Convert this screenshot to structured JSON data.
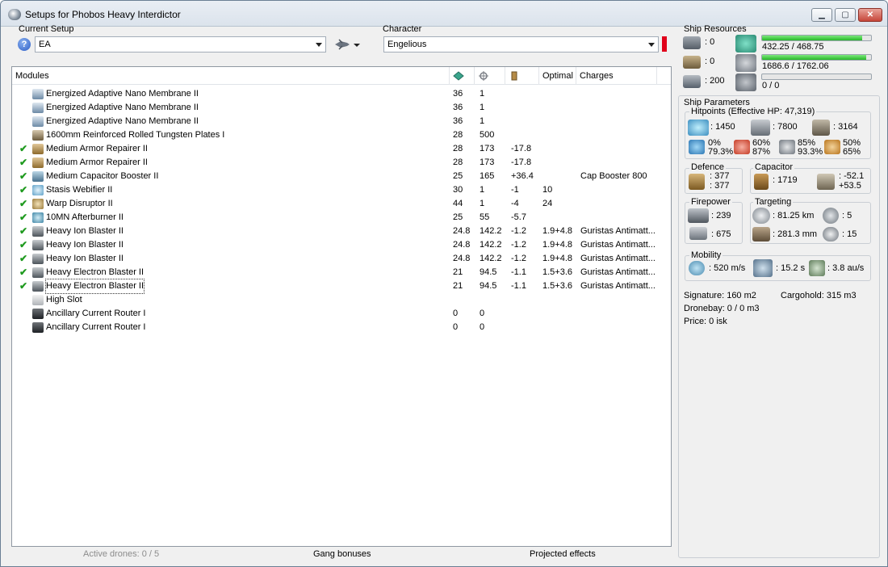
{
  "window": {
    "title": "Setups for Phobos Heavy Interdictor"
  },
  "setup": {
    "label": "Current Setup",
    "value": "EA"
  },
  "character": {
    "label": "Character",
    "value": "Engelious"
  },
  "modules": {
    "headers": {
      "modules": "Modules",
      "optimal": "Optimal",
      "charges": "Charges"
    },
    "rows": [
      {
        "checked": false,
        "name": "Energized Adaptive Nano Membrane II",
        "cpu": "36",
        "pg": "1",
        "cap": "",
        "optimal": "",
        "charges": "",
        "icon": "membrane-icon"
      },
      {
        "checked": false,
        "name": "Energized Adaptive Nano Membrane II",
        "cpu": "36",
        "pg": "1",
        "cap": "",
        "optimal": "",
        "charges": "",
        "icon": "membrane-icon"
      },
      {
        "checked": false,
        "name": "Energized Adaptive Nano Membrane II",
        "cpu": "36",
        "pg": "1",
        "cap": "",
        "optimal": "",
        "charges": "",
        "icon": "membrane-icon"
      },
      {
        "checked": false,
        "name": "1600mm Reinforced Rolled Tungsten Plates I",
        "cpu": "28",
        "pg": "500",
        "cap": "",
        "optimal": "",
        "charges": "",
        "icon": "armor-plate-icon"
      },
      {
        "checked": true,
        "name": "Medium Armor Repairer II",
        "cpu": "28",
        "pg": "173",
        "cap": "-17.8",
        "optimal": "",
        "charges": "",
        "icon": "armor-repairer-icon"
      },
      {
        "checked": true,
        "name": "Medium Armor Repairer II",
        "cpu": "28",
        "pg": "173",
        "cap": "-17.8",
        "optimal": "",
        "charges": "",
        "icon": "armor-repairer-icon"
      },
      {
        "checked": true,
        "name": "Medium Capacitor Booster II",
        "cpu": "25",
        "pg": "165",
        "cap": "+36.4",
        "optimal": "",
        "charges": "Cap Booster 800",
        "icon": "cap-booster-icon"
      },
      {
        "checked": true,
        "name": "Stasis Webifier II",
        "cpu": "30",
        "pg": "1",
        "cap": "-1",
        "optimal": "10",
        "charges": "",
        "icon": "webifier-icon"
      },
      {
        "checked": true,
        "name": "Warp Disruptor II",
        "cpu": "44",
        "pg": "1",
        "cap": "-4",
        "optimal": "24",
        "charges": "",
        "icon": "warp-disruptor-icon"
      },
      {
        "checked": true,
        "name": "10MN Afterburner II",
        "cpu": "25",
        "pg": "55",
        "cap": "-5.7",
        "optimal": "",
        "charges": "",
        "icon": "afterburner-icon"
      },
      {
        "checked": true,
        "name": "Heavy Ion Blaster II",
        "cpu": "24.8",
        "pg": "142.2",
        "cap": "-1.2",
        "optimal": "1.9+4.8",
        "charges": "Guristas Antimatt...",
        "icon": "blaster-icon"
      },
      {
        "checked": true,
        "name": "Heavy Ion Blaster II",
        "cpu": "24.8",
        "pg": "142.2",
        "cap": "-1.2",
        "optimal": "1.9+4.8",
        "charges": "Guristas Antimatt...",
        "icon": "blaster-icon"
      },
      {
        "checked": true,
        "name": "Heavy Ion Blaster II",
        "cpu": "24.8",
        "pg": "142.2",
        "cap": "-1.2",
        "optimal": "1.9+4.8",
        "charges": "Guristas Antimatt...",
        "icon": "blaster-icon"
      },
      {
        "checked": true,
        "name": "Heavy Electron Blaster II",
        "cpu": "21",
        "pg": "94.5",
        "cap": "-1.1",
        "optimal": "1.5+3.6",
        "charges": "Guristas Antimatt...",
        "icon": "blaster-icon"
      },
      {
        "checked": true,
        "name": "Heavy Electron Blaster II",
        "cpu": "21",
        "pg": "94.5",
        "cap": "-1.1",
        "optimal": "1.5+3.6",
        "charges": "Guristas Antimatt...",
        "icon": "blaster-icon"
      },
      {
        "checked": false,
        "name": "High Slot",
        "cpu": "",
        "pg": "",
        "cap": "",
        "optimal": "",
        "charges": "",
        "icon": "high-slot-icon"
      },
      {
        "checked": false,
        "name": "Ancillary Current Router I",
        "cpu": "0",
        "pg": "0",
        "cap": "",
        "optimal": "",
        "charges": "",
        "icon": "rig-icon"
      },
      {
        "checked": false,
        "name": "Ancillary Current Router I",
        "cpu": "0",
        "pg": "0",
        "cap": "",
        "optimal": "",
        "charges": "",
        "icon": "rig-icon"
      }
    ]
  },
  "bottom_tabs": {
    "drones": "Active drones: 0 / 5",
    "gang": "Gang bonuses",
    "projected": "Projected effects"
  },
  "resources": {
    "title": "Ship Resources",
    "turrets": ": 0",
    "launchers": ": 0",
    "calibration": ": 200",
    "cpu": "432.25 / 468.75",
    "cpu_fraction": 0.922,
    "powergrid": "1686.6 / 1762.06",
    "powergrid_fraction": 0.957,
    "drone_bandwidth": "0 / 0",
    "drone_bandwidth_fraction": 0
  },
  "parameters": {
    "title": "Ship Parameters",
    "hitpoints_title": "Hitpoints (Effective HP: 47,319)",
    "shield_hp": ": 1450",
    "armor_hp": ": 7800",
    "structure_hp": ": 3164",
    "resists": {
      "em_a": "0%",
      "em_b": "79.3%",
      "thermal_a": "60%",
      "thermal_b": "87%",
      "kinetic_a": "85%",
      "kinetic_b": "93.3%",
      "explosive_a": "50%",
      "explosive_b": "65%"
    },
    "defence_title": "Defence",
    "defence_a": ": 377",
    "defence_b": ": 377",
    "capacitor_title": "Capacitor",
    "capacitor_amount": ": 1719",
    "capacitor_delta_a": ": -52.1",
    "capacitor_delta_b": "+53.5",
    "firepower_title": "Firepower",
    "dps": ": 239",
    "volley": ": 675",
    "targeting_title": "Targeting",
    "range": ": 81.25 km",
    "max_targets": ": 5",
    "scan_res": ": 281.3 mm",
    "sensor_strength": ": 15",
    "mobility_title": "Mobility",
    "speed": ": 520 m/s",
    "align_time": ": 15.2 s",
    "warp_speed": ": 3.8 au/s",
    "signature": "Signature: 160 m2",
    "cargohold": "Cargohold: 315 m3",
    "dronebay": "Dronebay: 0 / 0 m3",
    "price": "Price: 0 isk"
  }
}
